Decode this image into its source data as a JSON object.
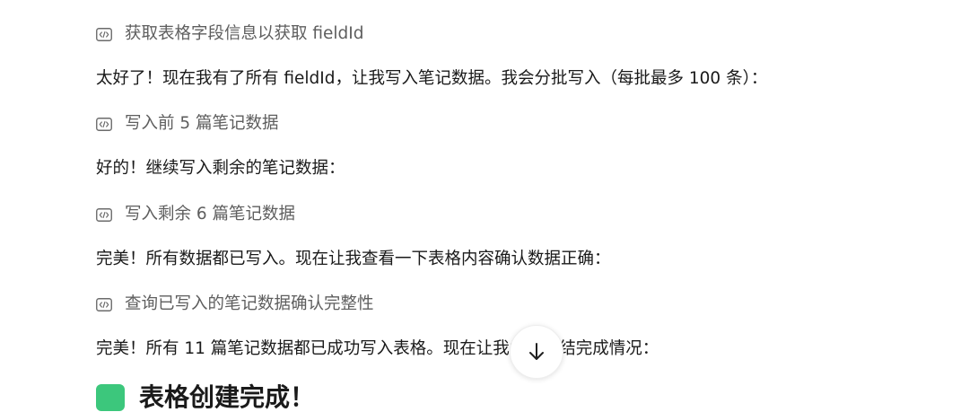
{
  "messages": [
    {
      "kind": "tool",
      "text": "获取表格字段信息以获取 fieldId",
      "icon": "code-block-icon"
    },
    {
      "kind": "text",
      "text": "太好了！现在我有了所有 fieldId，让我写入笔记数据。我会分批写入（每批最多 100 条）："
    },
    {
      "kind": "tool",
      "text": "写入前 5 篇笔记数据",
      "icon": "code-block-icon"
    },
    {
      "kind": "text",
      "text": "好的！继续写入剩余的笔记数据："
    },
    {
      "kind": "tool",
      "text": "写入剩余 6 篇笔记数据",
      "icon": "code-block-icon"
    },
    {
      "kind": "text",
      "text": "完美！所有数据都已写入。现在让我查看一下表格内容确认数据正确："
    },
    {
      "kind": "tool",
      "text": "查询已写入的笔记数据确认完整性",
      "icon": "code-block-icon"
    },
    {
      "kind": "text",
      "text": "完美！所有 11 篇笔记数据都已成功写入表格。现在让我为你总结完成情况："
    }
  ],
  "heading": {
    "text": "表格创建完成！"
  },
  "scroll_button": {
    "icon": "arrow-down-icon"
  },
  "colors": {
    "tool_text": "#5e5e5e",
    "body_text": "#1a1a1a",
    "badge": "#3cc77c"
  }
}
